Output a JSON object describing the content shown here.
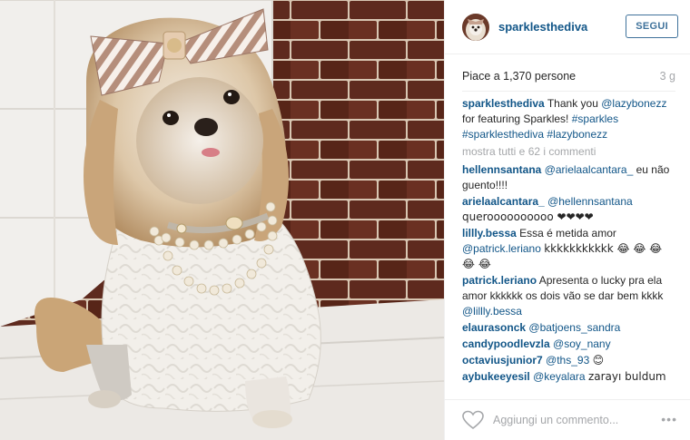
{
  "post": {
    "username": "sparklesthediva",
    "follow_label": "SEGUI",
    "likes_text": "Piace a 1,370 persone",
    "time_ago": "3 g",
    "icons": {
      "avatar": "profile-photo",
      "like": "heart-outline-icon",
      "more": "more-options-icon"
    }
  },
  "caption": {
    "user": "sparklesthediva",
    "text_before": "Thank you",
    "mention": "@lazybonezz",
    "text_after": "for featuring Sparkles!",
    "tag1": "#sparkles",
    "tag2": "#sparklesthediva",
    "tag3": "#lazybonezz"
  },
  "view_all_label": "mostra tutti e 62 i commenti",
  "comments": [
    {
      "user": "hellennsantana",
      "mention": "@arielaalcantara_",
      "text": "eu não guento!!!!"
    },
    {
      "user": "arielaalcantara_",
      "mention": "@hellennsantana",
      "text": "queroooooooooo ❤❤❤❤"
    },
    {
      "user": "lillly.bessa",
      "text": "Essa é metida amor",
      "mention": "@patrick.leriano",
      "text2": "kkkkkkkkkkk 😂 😂 😂 😂 😂"
    },
    {
      "user": "patrick.leriano",
      "text": "Apresenta o lucky pra ela amor kkkkkk os dois vão se dar bem kkkk",
      "mention": "@lillly.bessa"
    },
    {
      "user": "elaurasonck",
      "mention": "@batjoens_sandra"
    },
    {
      "user": "candypoodlevzla",
      "mention": "@soy_nany"
    },
    {
      "user": "octaviusjunior7",
      "mention": "@ths_93",
      "text": "😊"
    },
    {
      "user": "aybukeeyesil",
      "mention": "@keyalara",
      "text": "zarayı buldum ✋",
      "text2": "✋✋✋"
    }
  ],
  "add_comment_placeholder": "Aggiungi un commento...",
  "more_label": "•••",
  "colors": {
    "link": "#125688",
    "follow": "#3f729b",
    "muted": "#a5a7aa",
    "text": "#262626",
    "divider": "#efefef"
  }
}
